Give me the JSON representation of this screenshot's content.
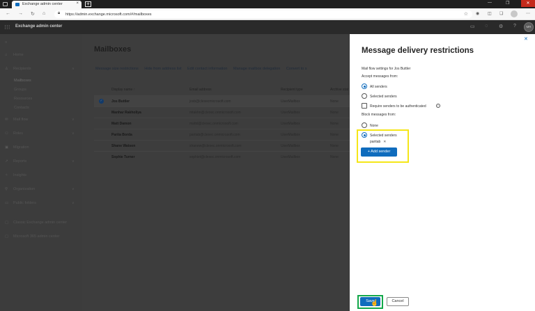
{
  "browser": {
    "tab_title": "Exchange admin center",
    "url": "https://admin.exchange.microsoft.com/#/mailboxes"
  },
  "app": {
    "title": "Exchange admin center",
    "user_initials": "MR"
  },
  "sidebar": {
    "items": [
      {
        "label": "Home",
        "icon": "home-icon"
      },
      {
        "label": "Recipients",
        "icon": "people-icon"
      },
      {
        "label": "Mail flow",
        "icon": "mail-icon"
      },
      {
        "label": "Roles",
        "icon": "roles-icon"
      },
      {
        "label": "Migration",
        "icon": "migration-icon"
      },
      {
        "label": "Reports",
        "icon": "chart-icon"
      },
      {
        "label": "Insights",
        "icon": "insights-icon"
      },
      {
        "label": "Organization",
        "icon": "org-icon"
      },
      {
        "label": "Public folders",
        "icon": "folder-icon"
      },
      {
        "label": "Classic Exchange admin center",
        "icon": "classic-icon"
      },
      {
        "label": "Microsoft 365 admin center",
        "icon": "m365-icon"
      }
    ],
    "recipients_sub": [
      "Mailboxes",
      "Groups",
      "Resources",
      "Contacts"
    ]
  },
  "main": {
    "title": "Mailboxes",
    "commands": [
      "Message size restrictions",
      "Hide from address list",
      "Edit contact information",
      "Manage mailbox delegation",
      "Convert to s"
    ],
    "columns": [
      "Display name ↑",
      "Email address",
      "Recipient type",
      "Archive stat"
    ],
    "rows": [
      {
        "name": "Jos Buttler",
        "email": "josb@clexecmicrosoft.com",
        "type": "UserMailbox",
        "archive": "None"
      },
      {
        "name": "Manhar Rakholiya",
        "email": "mtakhn@clexec.onmicrosoft.com",
        "type": "UserMailbox",
        "archive": "None"
      },
      {
        "name": "Matt Damon",
        "email": "mattd@clexec.onmicrosoft.com",
        "type": "UserMailbox",
        "archive": "None"
      },
      {
        "name": "Parita Borda",
        "email": "paritab@clexec.onmicrosoft.com",
        "type": "UserMailbox",
        "archive": "None"
      },
      {
        "name": "Shane Watson",
        "email": "shanew@clexec.onmicrosoft.com",
        "type": "UserMailbox",
        "archive": "None"
      },
      {
        "name": "Sophie Turner",
        "email": "sophiet@clexec.onmicrosoft.com",
        "type": "UserMailbox",
        "archive": "None"
      }
    ]
  },
  "panel": {
    "title": "Message delivery restrictions",
    "subtitle": "Mail flow settings for Jos Buttler",
    "accept_label": "Accept messages from:",
    "accept_all": "All senders",
    "accept_selected": "Selected senders",
    "require_auth": "Require senders to be authenticated",
    "block_label": "Block messages from:",
    "block_none": "None",
    "block_selected": "Selected senders",
    "chip": "paritab",
    "add_sender": "+ Add sender",
    "save": "Save",
    "cancel": "Cancel"
  }
}
